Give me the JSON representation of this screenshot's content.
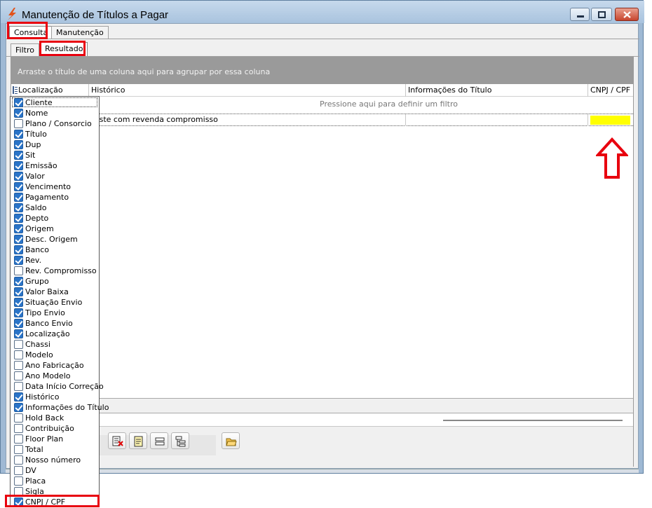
{
  "window": {
    "title": "Manutenção de Títulos a Pagar",
    "accent_color": "#e8000e",
    "icons": {
      "app": "lightning-icon",
      "minimize": "minimize-icon",
      "maximize": "maximize-icon",
      "close": "close-icon"
    }
  },
  "tabs": [
    {
      "label": "Consulta",
      "selected": true
    },
    {
      "label": "Manutenção",
      "selected": false
    }
  ],
  "subtabs": [
    {
      "label": "Filtro",
      "selected": false
    },
    {
      "label": "Resultado",
      "selected": true
    }
  ],
  "grid": {
    "group_hint": "Arraste o título de uma coluna aqui para agrupar por essa coluna",
    "columns": [
      "Localização",
      "Histórico",
      "Informações do Título",
      "CNPJ / CPF"
    ],
    "filter_hint": "Pressione aqui para definir um filtro",
    "rows": [
      {
        "localizacao": "",
        "historico": "Teste com revenda compromisso",
        "informacoes": "",
        "cnpj_cpf": ""
      }
    ],
    "highlight_cell_color": "#ffff00"
  },
  "toolbar": {
    "icons": [
      "export-excel-icon",
      "report-icon",
      "collapse-icon",
      "expand-tree-icon",
      "open-folder-icon"
    ]
  },
  "column_chooser": {
    "items": [
      {
        "label": "Cliente",
        "checked": true
      },
      {
        "label": "Nome",
        "checked": true
      },
      {
        "label": "Plano / Consorcio",
        "checked": false
      },
      {
        "label": "Título",
        "checked": true
      },
      {
        "label": "Dup",
        "checked": true
      },
      {
        "label": "Sit",
        "checked": true
      },
      {
        "label": "Emissão",
        "checked": true
      },
      {
        "label": "Valor",
        "checked": true
      },
      {
        "label": "Vencimento",
        "checked": true
      },
      {
        "label": "Pagamento",
        "checked": true
      },
      {
        "label": "Saldo",
        "checked": true
      },
      {
        "label": "Depto",
        "checked": true
      },
      {
        "label": "Origem",
        "checked": true
      },
      {
        "label": "Desc. Origem",
        "checked": true
      },
      {
        "label": "Banco",
        "checked": true
      },
      {
        "label": "Rev.",
        "checked": true
      },
      {
        "label": "Rev. Compromisso",
        "checked": false
      },
      {
        "label": "Grupo",
        "checked": true
      },
      {
        "label": "Valor Baixa",
        "checked": true
      },
      {
        "label": "Situação Envio",
        "checked": true
      },
      {
        "label": "Tipo Envio",
        "checked": true
      },
      {
        "label": "Banco Envio",
        "checked": true
      },
      {
        "label": "Localização",
        "checked": true
      },
      {
        "label": "Chassi",
        "checked": false
      },
      {
        "label": "Modelo",
        "checked": false
      },
      {
        "label": "Ano Fabricação",
        "checked": false
      },
      {
        "label": "Ano Modelo",
        "checked": false
      },
      {
        "label": "Data Início Correção",
        "checked": false
      },
      {
        "label": "Histórico",
        "checked": true
      },
      {
        "label": "Informações do Título",
        "checked": true
      },
      {
        "label": "Hold Back",
        "checked": false
      },
      {
        "label": "Contribuição",
        "checked": false
      },
      {
        "label": "Floor Plan",
        "checked": false
      },
      {
        "label": "Total",
        "checked": false
      },
      {
        "label": "Nosso número",
        "checked": false
      },
      {
        "label": "DV",
        "checked": false
      },
      {
        "label": "Placa",
        "checked": false
      },
      {
        "label": "Sigla",
        "checked": false
      },
      {
        "label": "CNPJ / CPF",
        "checked": true
      }
    ]
  }
}
